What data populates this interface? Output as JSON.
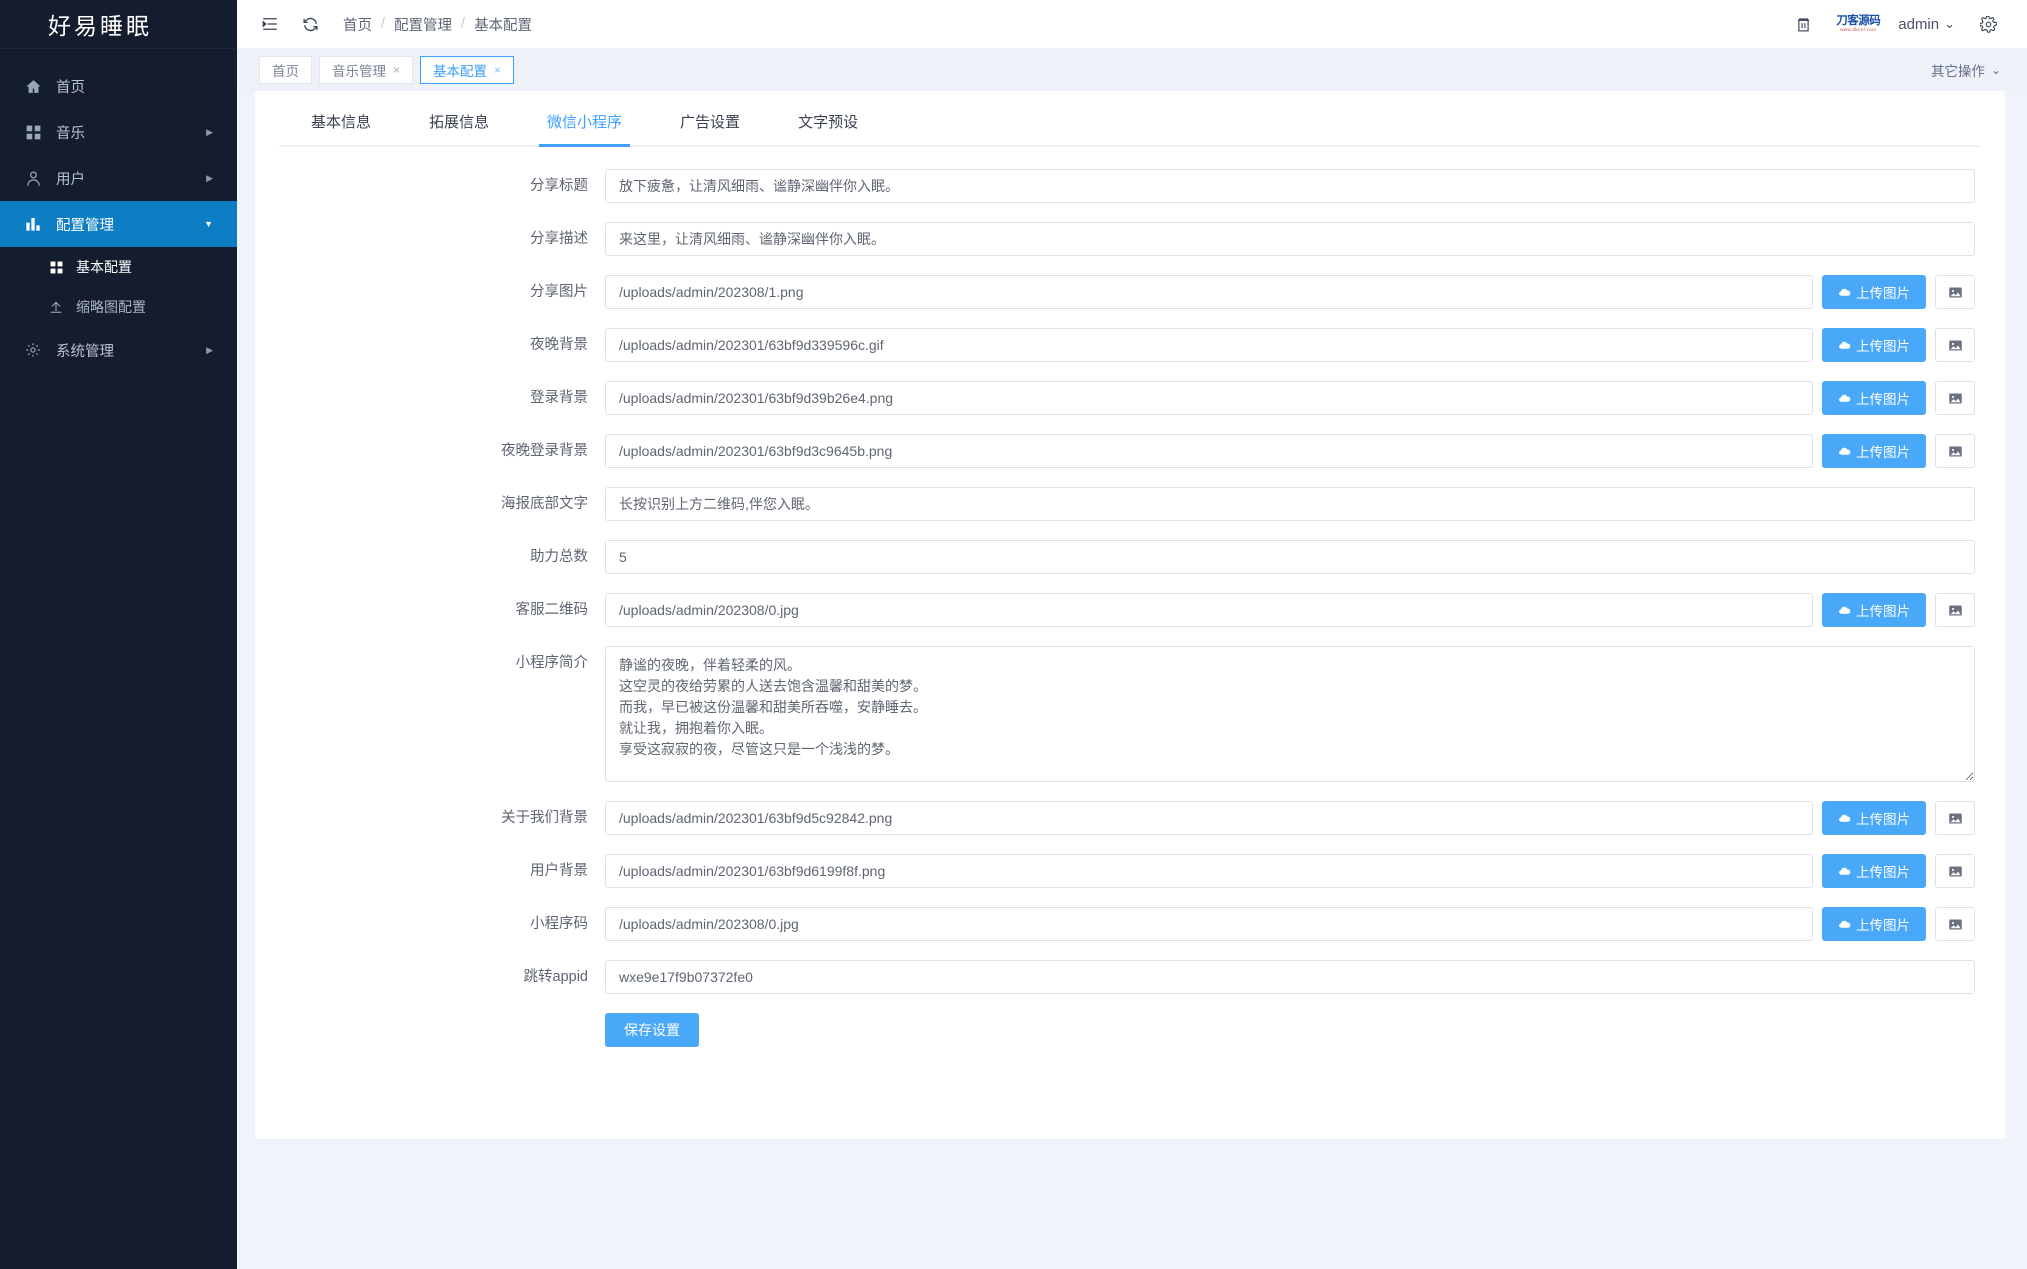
{
  "sidebar": {
    "brand": "好易睡眠",
    "items": [
      {
        "label": "首页",
        "icon": "home-icon",
        "arrow": ""
      },
      {
        "label": "音乐",
        "icon": "grid-icon",
        "arrow": "▶"
      },
      {
        "label": "用户",
        "icon": "user-icon",
        "arrow": "▶"
      },
      {
        "label": "配置管理",
        "icon": "chart-icon",
        "arrow": "▼",
        "active": true
      }
    ],
    "subitems": [
      {
        "label": "基本配置",
        "icon": "grid-icon",
        "current": true
      },
      {
        "label": "缩略图配置",
        "icon": "upload-icon",
        "current": false
      }
    ],
    "system": {
      "label": "系统管理",
      "icon": "gear-icon",
      "arrow": "▶"
    }
  },
  "header": {
    "menu_fold_icon": "menu-fold-icon",
    "refresh_icon": "refresh-icon",
    "breadcrumb": [
      "首页",
      "配置管理",
      "基本配置"
    ],
    "breadcrumb_sep": "/",
    "trash_icon": "trash-icon",
    "logo_main": "刀客源码",
    "logo_sub": "www.dkcel.com",
    "user": "admin",
    "user_caret": "⌄",
    "settings_icon": "gear-icon"
  },
  "tabstrip": {
    "tabs": [
      {
        "label": "首页",
        "closable": false,
        "active": false
      },
      {
        "label": "音乐管理",
        "closable": true,
        "active": false
      },
      {
        "label": "基本配置",
        "closable": true,
        "active": true
      }
    ],
    "close_glyph": "×",
    "other_ops": "其它操作",
    "other_ops_caret": "⌄"
  },
  "form_tabs": [
    {
      "label": "基本信息",
      "active": false
    },
    {
      "label": "拓展信息",
      "active": false
    },
    {
      "label": "微信小程序",
      "active": true
    },
    {
      "label": "广告设置",
      "active": false
    },
    {
      "label": "文字预设",
      "active": false
    }
  ],
  "buttons": {
    "upload_label": "上传图片",
    "upload_icon": "cloud-upload-icon",
    "picture_icon": "picture-icon",
    "save_label": "保存设置"
  },
  "fields": [
    {
      "label": "分享标题",
      "value": "放下疲惫，让清风细雨、谧静深幽伴你入眠。",
      "type": "text"
    },
    {
      "label": "分享描述",
      "value": "来这里，让清风细雨、谧静深幽伴你入眠。",
      "type": "text"
    },
    {
      "label": "分享图片",
      "value": "/uploads/admin/202308/1.png",
      "type": "upload"
    },
    {
      "label": "夜晚背景",
      "value": "/uploads/admin/202301/63bf9d339596c.gif",
      "type": "upload"
    },
    {
      "label": "登录背景",
      "value": "/uploads/admin/202301/63bf9d39b26e4.png",
      "type": "upload"
    },
    {
      "label": "夜晚登录背景",
      "value": "/uploads/admin/202301/63bf9d3c9645b.png",
      "type": "upload"
    },
    {
      "label": "海报底部文字",
      "value": "长按识别上方二维码,伴您入眠。",
      "type": "text"
    },
    {
      "label": "助力总数",
      "value": "5",
      "type": "text"
    },
    {
      "label": "客服二维码",
      "value": "/uploads/admin/202308/0.jpg",
      "type": "upload"
    },
    {
      "label": "小程序简介",
      "value": "静谧的夜晚，伴着轻柔的风。\n这空灵的夜给劳累的人送去饱含温馨和甜美的梦。\n而我，早已被这份温馨和甜美所吞噬，安静睡去。\n就让我，拥抱着你入眠。\n享受这寂寂的夜，尽管这只是一个浅浅的梦。",
      "type": "textarea"
    },
    {
      "label": "关于我们背景",
      "value": "/uploads/admin/202301/63bf9d5c92842.png",
      "type": "upload"
    },
    {
      "label": "用户背景",
      "value": "/uploads/admin/202301/63bf9d6199f8f.png",
      "type": "upload"
    },
    {
      "label": "小程序码",
      "value": "/uploads/admin/202308/0.jpg",
      "type": "upload"
    },
    {
      "label": "跳转appid",
      "value": "wxe9e17f9b07372fe0",
      "type": "text"
    }
  ],
  "colors": {
    "sidebar_bg": "#141d2e",
    "sidebar_active": "#0d7ec4",
    "accent": "#409eff",
    "button_blue": "#49a8f7",
    "page_bg": "#f0f3fa"
  }
}
